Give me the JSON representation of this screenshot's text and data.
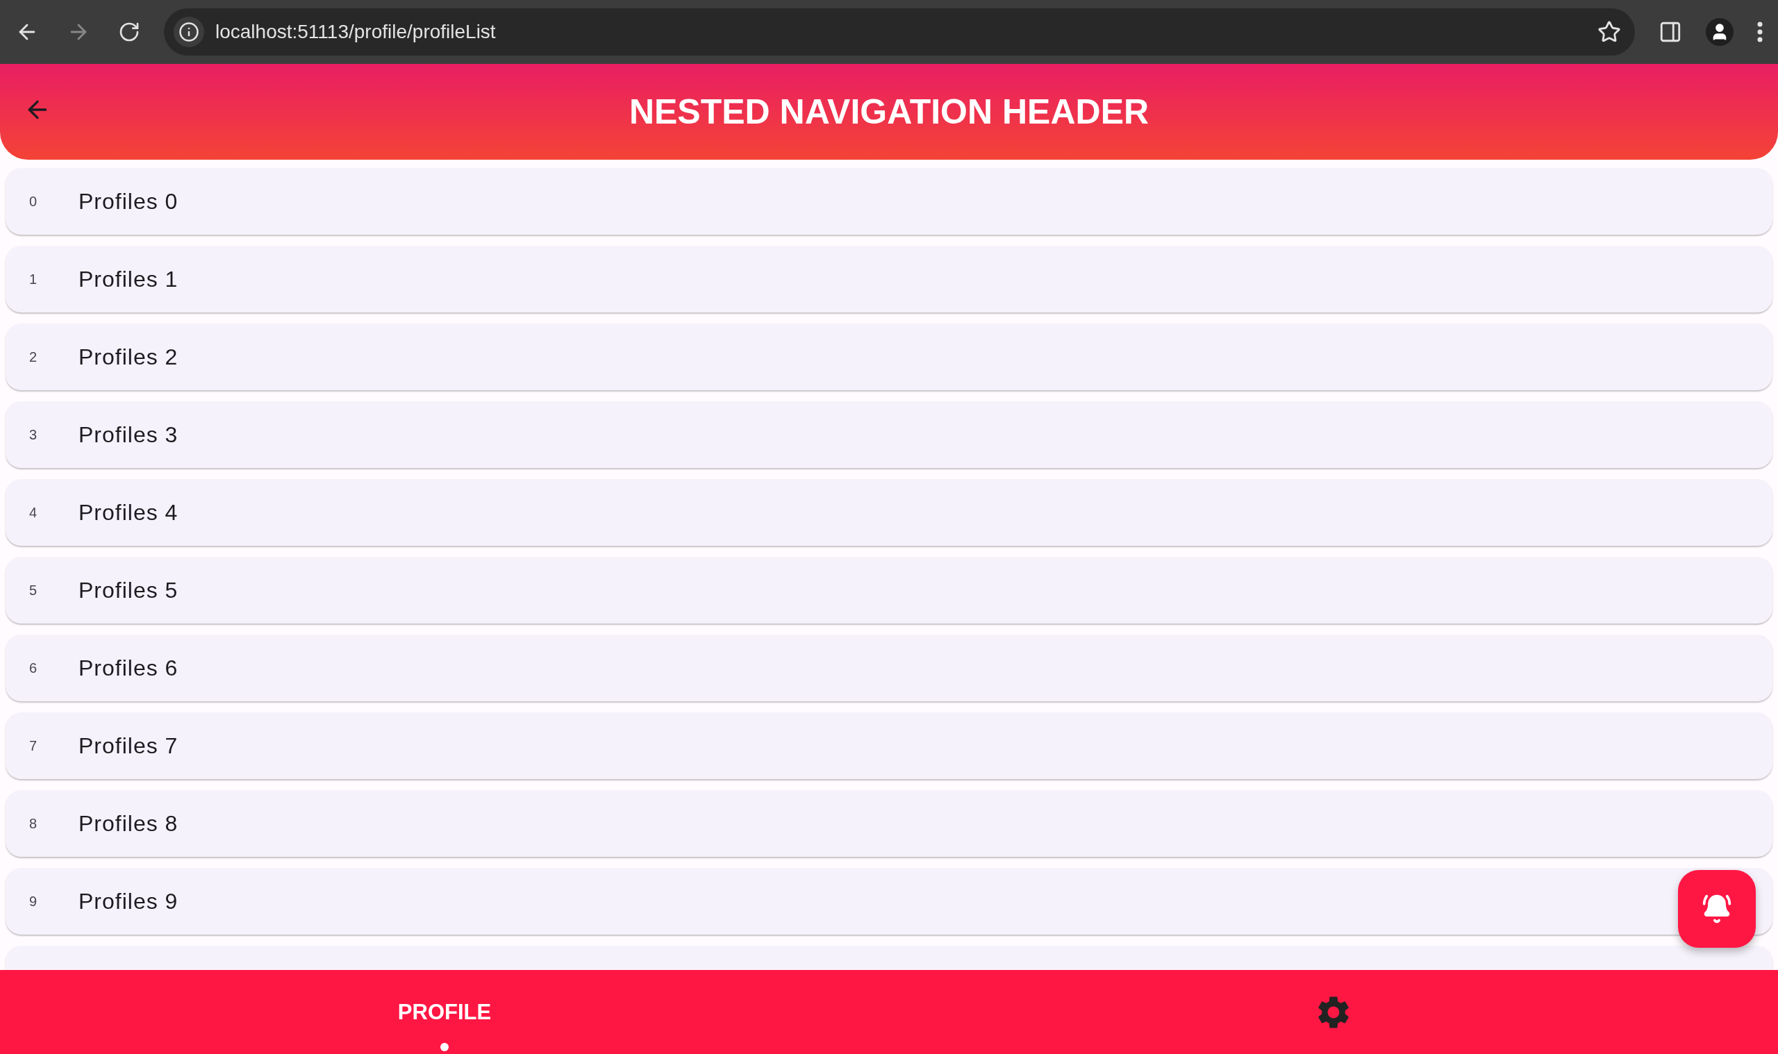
{
  "browser": {
    "url": "localhost:51113/profile/profileList",
    "forward_disabled": true
  },
  "header": {
    "title": "NESTED NAVIGATION HEADER"
  },
  "profiles": [
    {
      "index": "0",
      "label": "Profiles 0"
    },
    {
      "index": "1",
      "label": "Profiles 1"
    },
    {
      "index": "2",
      "label": "Profiles 2"
    },
    {
      "index": "3",
      "label": "Profiles 3"
    },
    {
      "index": "4",
      "label": "Profiles 4"
    },
    {
      "index": "5",
      "label": "Profiles 5"
    },
    {
      "index": "6",
      "label": "Profiles 6"
    },
    {
      "index": "7",
      "label": "Profiles 7"
    },
    {
      "index": "8",
      "label": "Profiles 8"
    },
    {
      "index": "9",
      "label": "Profiles 9"
    }
  ],
  "bottom_nav": [
    {
      "kind": "label",
      "label": "PROFILE",
      "selected": true
    },
    {
      "kind": "settings",
      "selected": false
    }
  ]
}
